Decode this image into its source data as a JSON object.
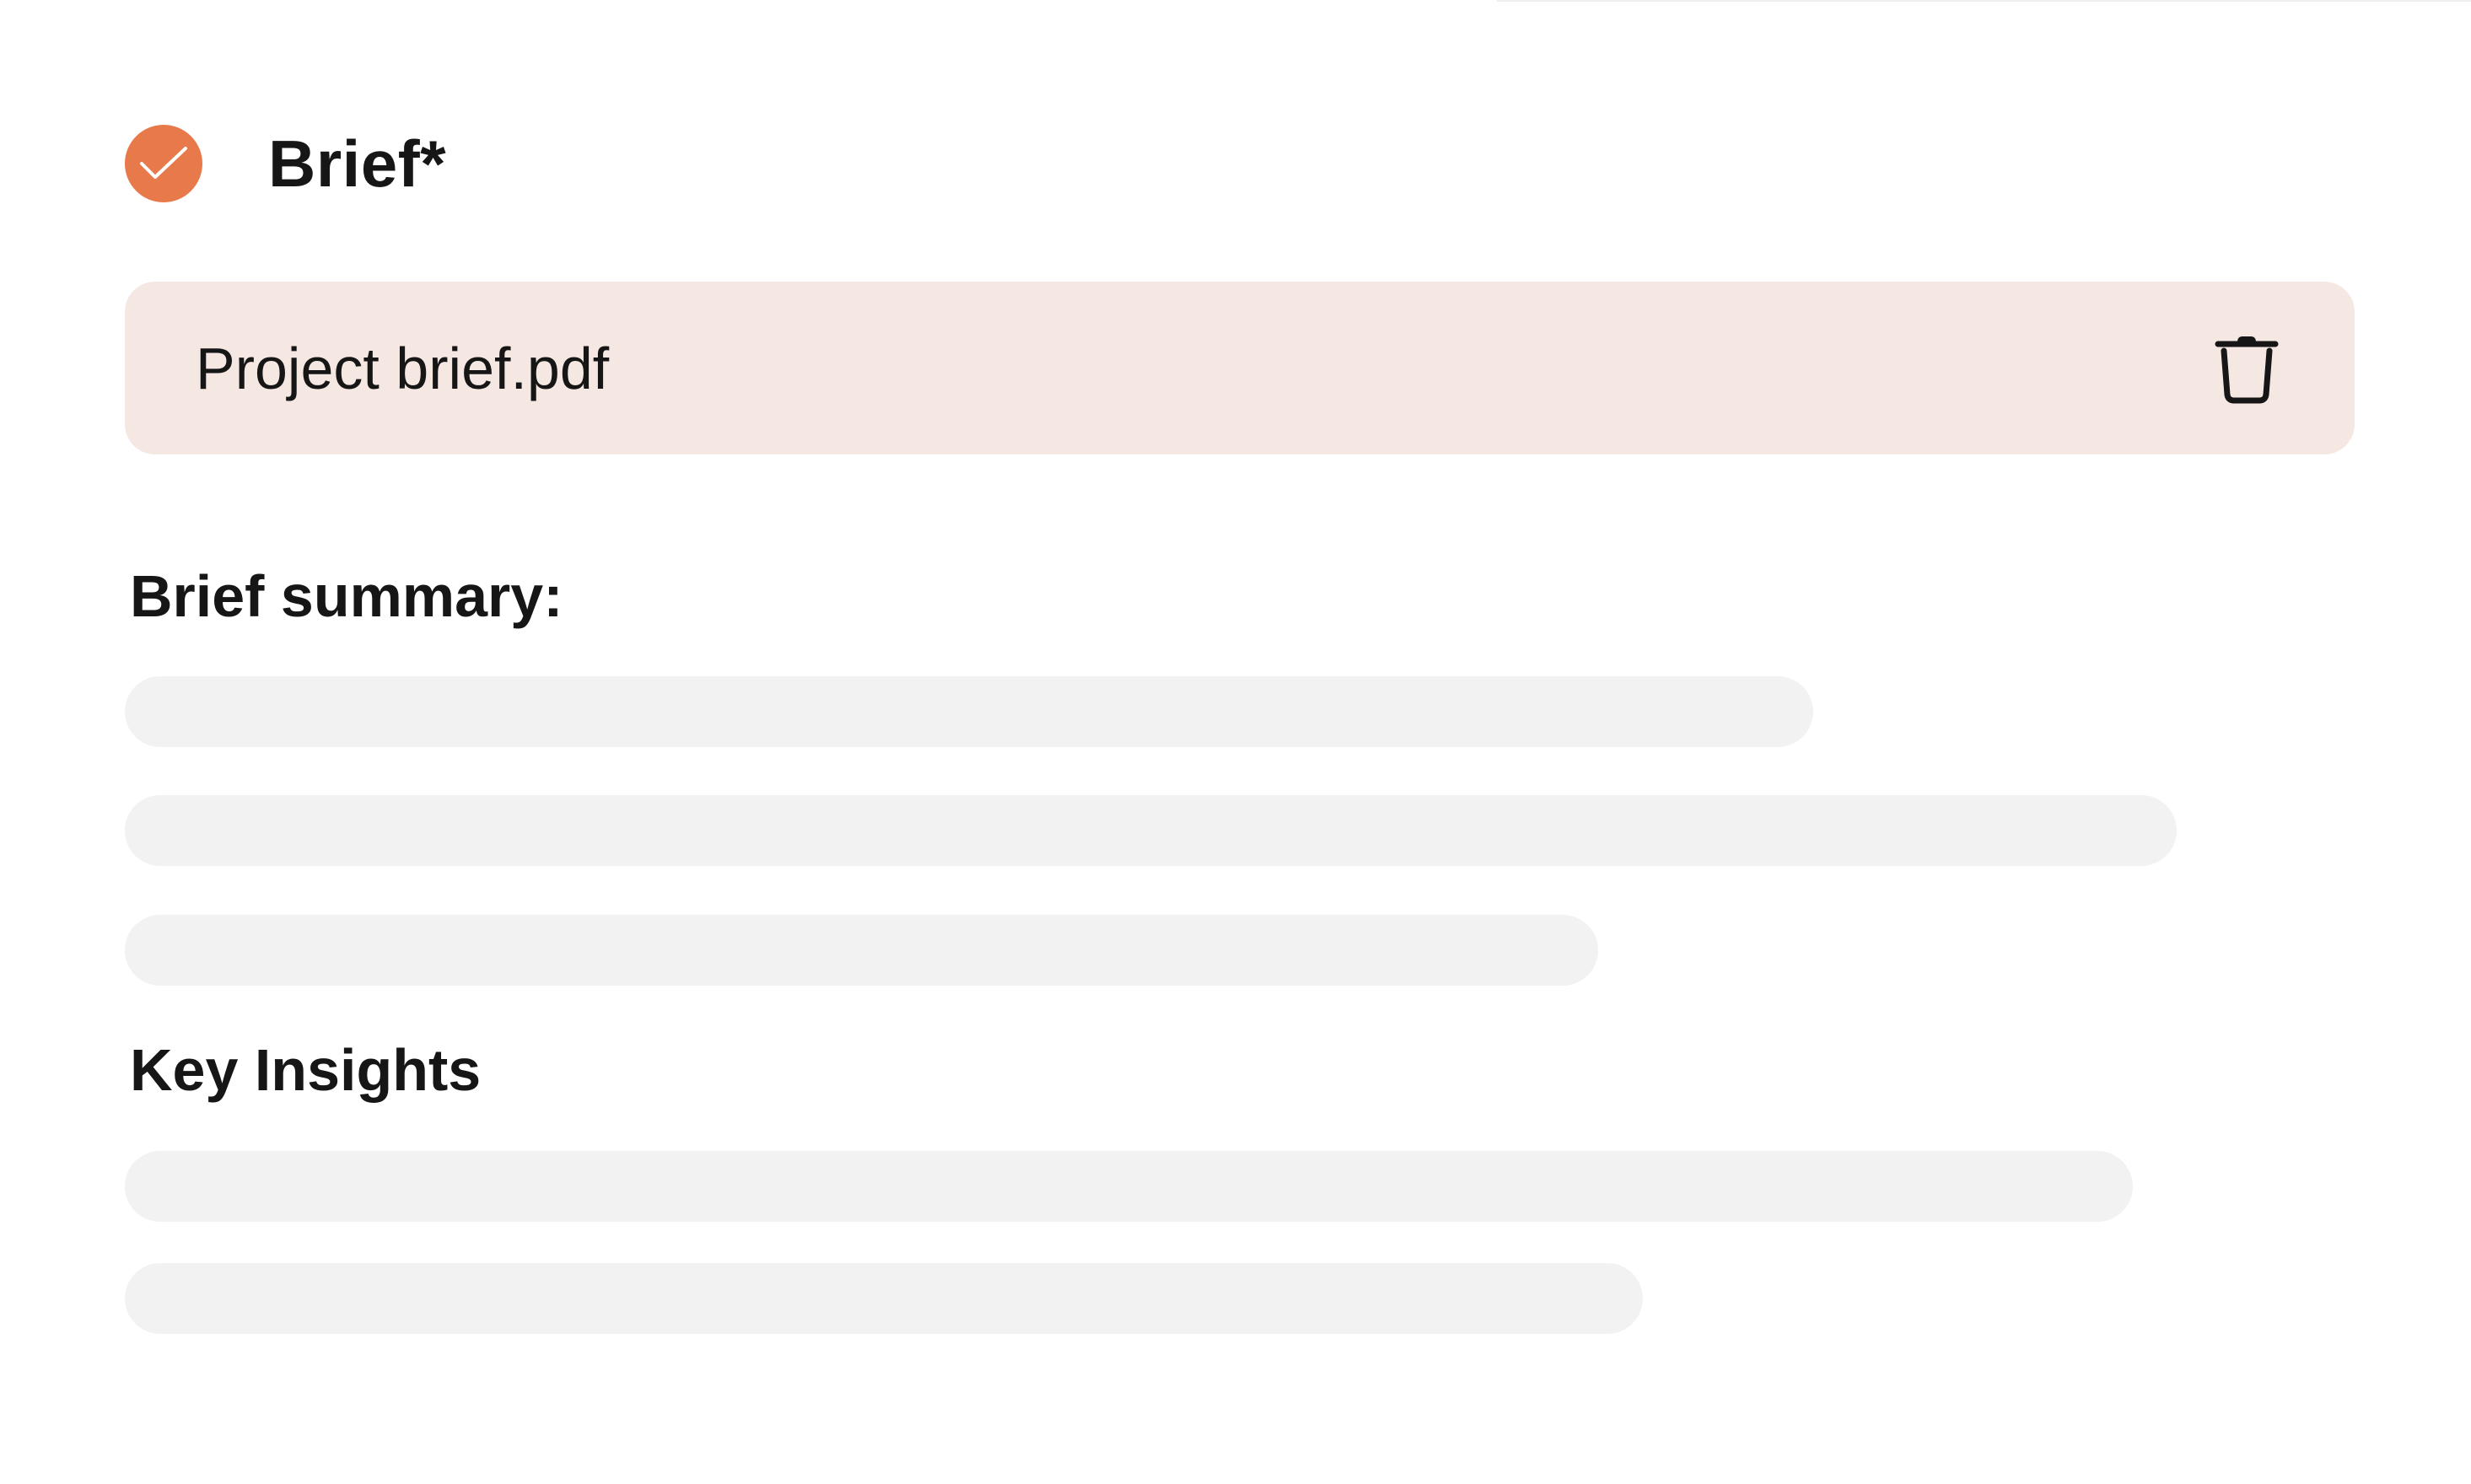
{
  "step": {
    "title": "Brief*",
    "status_icon": "check-circle-icon",
    "accent_color": "#e8794a"
  },
  "file": {
    "name": "Project brief.pdf",
    "delete_icon": "trash-icon",
    "card_color": "#f5e7e2"
  },
  "summary": {
    "title": "Brief summary:",
    "placeholder_lines": 3
  },
  "insights": {
    "title": "Key Insights",
    "placeholder_lines": 2
  },
  "placeholder_color": "#f2f2f2"
}
